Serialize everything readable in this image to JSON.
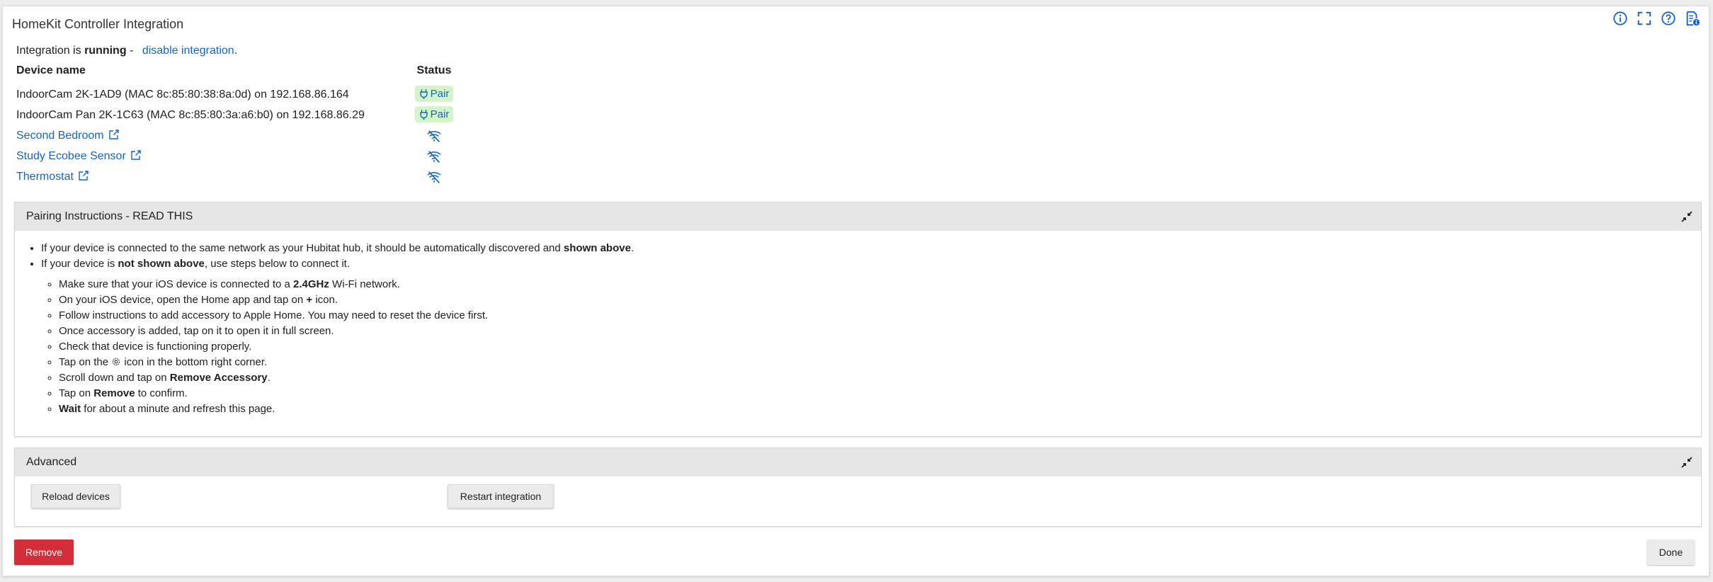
{
  "title": "HomeKit Controller Integration",
  "top_icons": [
    "info-icon",
    "fullscreen-icon",
    "help-icon",
    "documentation-icon"
  ],
  "integration": {
    "prefix": "Integration is ",
    "state": "running",
    "separator": " - ",
    "disable_link": "disable integration",
    "suffix": "."
  },
  "devices_table": {
    "headers": {
      "name": "Device name",
      "status": "Status"
    },
    "rows": [
      {
        "name": "IndoorCam 2K-1AD9 (MAC 8c:85:80:38:8a:0d) on 192.168.86.164",
        "status": "Pair",
        "link": false
      },
      {
        "name": "IndoorCam Pan 2K-1C63 (MAC 8c:85:80:3a:a6:b0) on 192.168.86.29",
        "status": "Pair",
        "link": false
      },
      {
        "name": "Second Bedroom",
        "status": "wifi-off-icon",
        "link": true
      },
      {
        "name": "Study Ecobee Sensor",
        "status": "wifi-off-icon",
        "link": true
      },
      {
        "name": "Thermostat",
        "status": "wifi-off-icon",
        "link": true
      }
    ]
  },
  "pairing": {
    "header": "Pairing Instructions - READ THIS",
    "b1_text": "If your device is connected to the same network as your Hubitat hub, it should be automatically discovered and ",
    "b1_bold": "shown above",
    "b1_end": ".",
    "b2_text": "If your device is ",
    "b2_bold": "not shown above",
    "b2_end": ", use steps below to connect it.",
    "s1_text": "Make sure that your iOS device is connected to a ",
    "s1_bold": "2.4GHz",
    "s1_end": " Wi-Fi network.",
    "s2_text": "On your iOS device, open the Home app and tap on ",
    "s2_bold": "+",
    "s2_end": " icon.",
    "s3": "Follow instructions to add accessory to Apple Home. You may need to reset the device first.",
    "s4": "Once accessory is added, tap on it to open it in full screen.",
    "s5": "Check that device is functioning properly.",
    "s6_text": "Tap on the ",
    "s6_end": " icon in the bottom right corner.",
    "s7_text": "Scroll down and tap on ",
    "s7_bold": "Remove Accessory",
    "s7_end": ".",
    "s8_text": "Tap on ",
    "s8_bold": "Remove",
    "s8_end": " to confirm.",
    "s9_bold": "Wait",
    "s9_end": " for about a minute and refresh this page."
  },
  "advanced": {
    "header": "Advanced",
    "reload_label": "Reload devices",
    "restart_label": "Restart integration"
  },
  "footer": {
    "remove_label": "Remove",
    "done_label": "Done"
  },
  "colors": {
    "link": "#1565c0",
    "pair_badge_bg": "#d4f5cc",
    "remove_button": "#d32f3b",
    "panel_header": "#e6e6e6"
  }
}
